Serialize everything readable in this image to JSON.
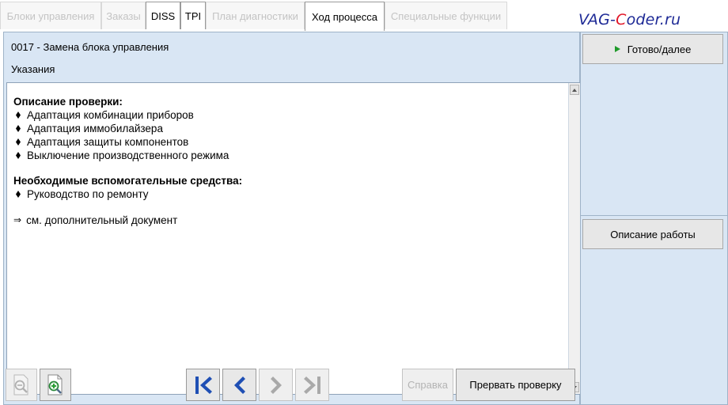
{
  "tabs": [
    {
      "label": "Блоки управления",
      "state": "disabled"
    },
    {
      "label": "Заказы",
      "state": "disabled"
    },
    {
      "label": "DISS",
      "state": "enabled"
    },
    {
      "label": "TPI",
      "state": "enabled"
    },
    {
      "label": "План диагностики",
      "state": "disabled"
    },
    {
      "label": "Ход процесса",
      "state": "active"
    },
    {
      "label": "Специальные функции",
      "state": "disabled"
    }
  ],
  "watermark": {
    "prefix": "VAG-",
    "highlight": "C",
    "suffix": "oder.ru"
  },
  "panel": {
    "title": "0017 - Замена блока управления",
    "subtitle": "Указания"
  },
  "content": {
    "section1_heading": "Описание проверки:",
    "section1_items": [
      "Адаптация комбинации приборов",
      "Адаптация иммобилайзера",
      "Адаптация защиты компонентов",
      "Выключение производственного режима"
    ],
    "section2_heading": "Необходимые вспомогательные средства:",
    "section2_items": [
      "Руководство по ремонту"
    ],
    "link_text": "см. дополнительный документ"
  },
  "toolbar": {
    "zoom_out_icon": "zoom-out-icon",
    "zoom_in_icon": "zoom-in-icon",
    "first_icon": "skip-to-first-icon",
    "prev_icon": "back-arrow-icon",
    "next_icon": "forward-arrow-icon",
    "last_icon": "skip-to-last-icon",
    "help_label": "Справка",
    "abort_label": "Прервать проверку"
  },
  "right": {
    "next_label": "Готово/далее",
    "description_label": "Описание работы"
  },
  "colors": {
    "panel_bg": "#d9e6f4",
    "nav_active": "#1f4fb4",
    "nav_disabled": "#a9a9a9",
    "play_green": "#1f9a2a",
    "brand_blue": "#1e2a96",
    "brand_red": "#e2182a"
  }
}
